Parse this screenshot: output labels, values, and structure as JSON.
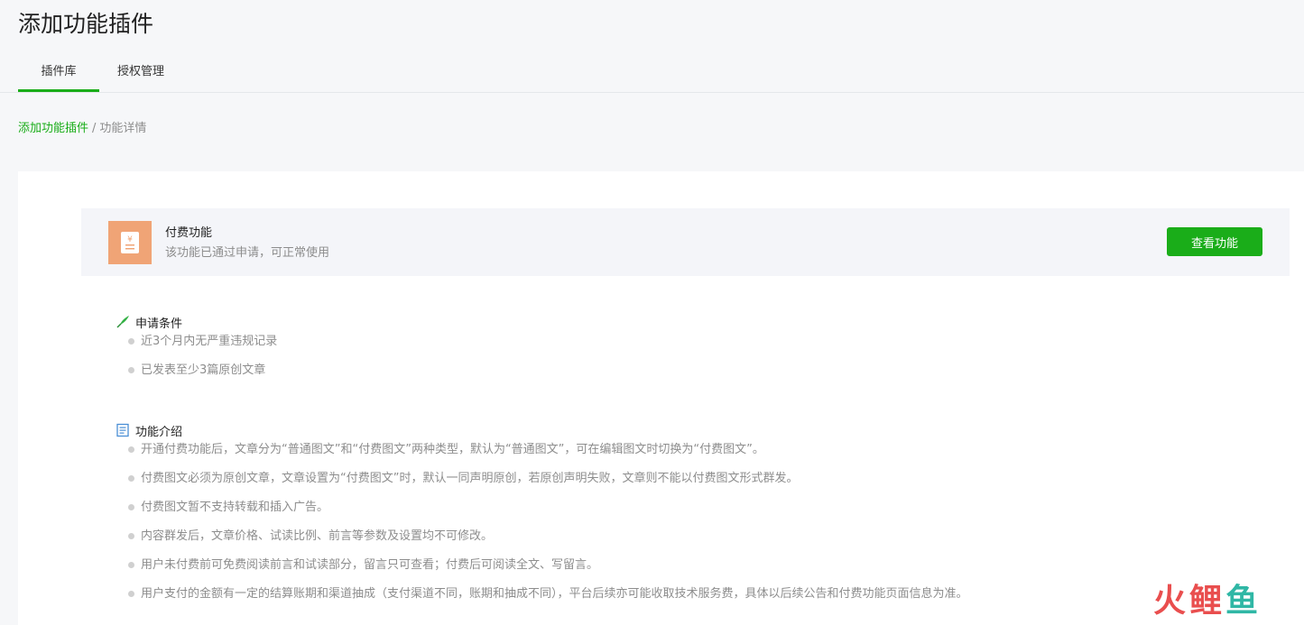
{
  "header": {
    "title": "添加功能插件"
  },
  "tabs": [
    {
      "label": "插件库",
      "active": true
    },
    {
      "label": "授权管理",
      "active": false
    }
  ],
  "breadcrumb": {
    "link": "添加功能插件",
    "separator": "/",
    "current": "功能详情"
  },
  "feature": {
    "name": "付费功能",
    "status": "该功能已通过申请，可正常使用",
    "icon": "yen-receipt-icon",
    "button_label": "查看功能"
  },
  "conditions": {
    "title": "申请条件",
    "icon": "leaf-pencil-icon",
    "items": [
      "近3个月内无严重违规记录",
      "已发表至少3篇原创文章"
    ]
  },
  "intro": {
    "title": "功能介绍",
    "icon": "document-icon",
    "items": [
      "开通付费功能后，文章分为“普通图文”和“付费图文”两种类型，默认为“普通图文”，可在编辑图文时切换为“付费图文”。",
      "付费图文必须为原创文章，文章设置为“付费图文”时，默认一同声明原创，若原创声明失败，文章则不能以付费图文形式群发。",
      "付费图文暂不支持转载和插入广告。",
      "内容群发后，文章价格、试读比例、前言等参数及设置均不可修改。",
      "用户未付费前可免费阅读前言和试读部分，留言只可查看；付费后可阅读全文、写留言。",
      "用户支付的金额有一定的结算账期和渠道抽成（支付渠道不同，账期和抽成不同），平台后续亦可能收取技术服务费，具体以后续公告和付费功能页面信息为准。"
    ]
  },
  "watermark": {
    "chars": [
      "火",
      "鲤",
      "鱼"
    ]
  },
  "colors": {
    "accent": "#1aad19",
    "icon_bg": "#f0a476"
  }
}
